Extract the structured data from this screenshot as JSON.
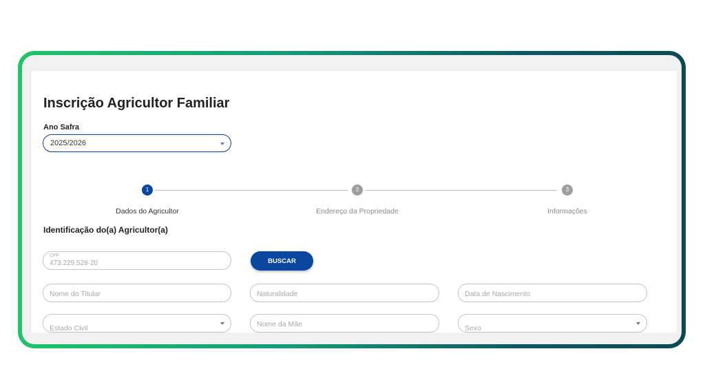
{
  "page": {
    "title": "Inscrição Agricultor Familiar"
  },
  "ano_safra": {
    "label": "Ano Safra",
    "value": "2025/2026"
  },
  "stepper": {
    "steps": [
      {
        "number": "1",
        "label": "Dados do Agricultor",
        "active": true
      },
      {
        "number": "2",
        "label": "Endereço da Propriedade",
        "active": false
      },
      {
        "number": "3",
        "label": "Informações",
        "active": false
      }
    ]
  },
  "form": {
    "section_title": "Identificação do(a) Agricultor(a)",
    "cpf": {
      "label": "CPF",
      "value": "473.229.528-20"
    },
    "buscar_label": "BUSCAR",
    "nome_titular": {
      "placeholder": "Nome do Titular"
    },
    "naturalidade": {
      "placeholder": "Naturalidade"
    },
    "data_nascimento": {
      "placeholder": "Data de Nascimento"
    },
    "estado_civil": {
      "placeholder": "Estado Civil"
    },
    "nome_mae": {
      "placeholder": "Nome da Mãe"
    },
    "sexo": {
      "placeholder": "Sexo"
    }
  },
  "colors": {
    "primary": "#0a47a0",
    "frame_gradient_start": "#1fc46a",
    "frame_gradient_end": "#0b4a55",
    "inactive_step": "#9e9e9e"
  }
}
